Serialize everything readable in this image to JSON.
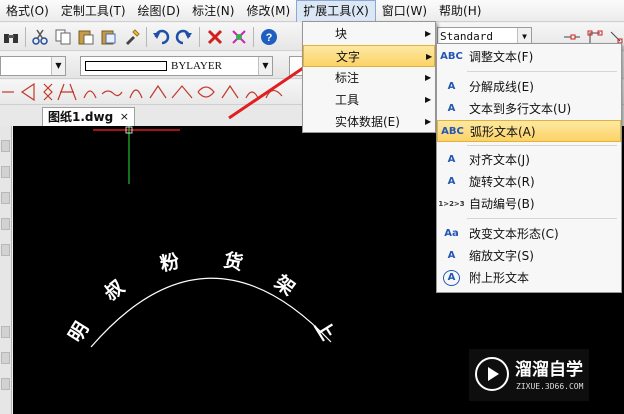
{
  "menubar": {
    "items": [
      "格式(O)",
      "定制工具(T)",
      "绘图(D)",
      "标注(N)",
      "修改(M)",
      "扩展工具(X)",
      "窗口(W)",
      "帮助(H)"
    ]
  },
  "toolbar": {
    "text_style": "Standard",
    "linetype": "BYLAYER"
  },
  "tab": {
    "title": "图纸1.dwg",
    "close": "×"
  },
  "menu_extend": {
    "items": [
      "块",
      "文字",
      "标注",
      "工具",
      "实体数据(E)"
    ]
  },
  "menu_text": {
    "items": [
      {
        "label": "调整文本(F)",
        "icon": "ABC"
      },
      {
        "label": "分解成线(E)",
        "icon": "A"
      },
      {
        "label": "文本到多行文本(U)",
        "icon": "A"
      },
      {
        "label": "弧形文本(A)",
        "icon": "ABC"
      },
      {
        "label": "对齐文本(J)",
        "icon": "A"
      },
      {
        "label": "旋转文本(R)",
        "icon": "A"
      },
      {
        "label": "自动编号(B)",
        "icon": "1>2>3"
      },
      {
        "label": "改变文本形态(C)",
        "icon": "Aa"
      },
      {
        "label": "缩放文字(S)",
        "icon": "A"
      },
      {
        "label": "附上形文本",
        "icon": "A"
      }
    ]
  },
  "canvas": {
    "arc_text": [
      "明",
      "叔",
      "粉",
      "货",
      "架",
      "上"
    ]
  },
  "watermark": {
    "title": "溜溜自学",
    "url": "ZIXUE.3D66.COM"
  },
  "colors": {
    "highlight": "#fbd266",
    "crosshair_red": "#ff2020",
    "crosshair_green": "#1fbf2f",
    "arrow_red": "#e02020"
  }
}
